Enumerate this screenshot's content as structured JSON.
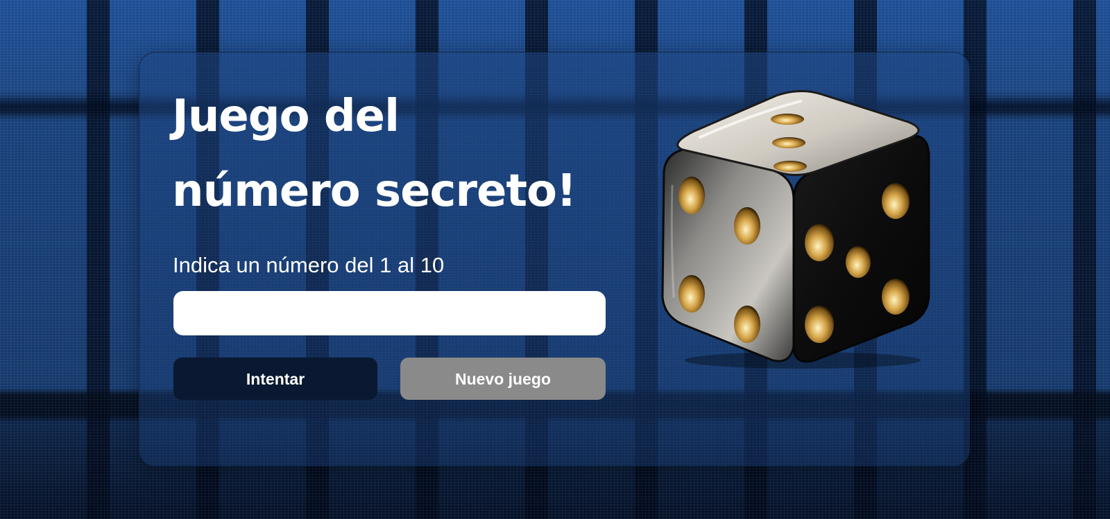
{
  "game": {
    "title_line1": "Juego del",
    "title_line2": "número secreto!",
    "prompt": "Indica un número del 1 al 10",
    "input_value": "",
    "try_button": "Intentar",
    "new_game_button": "Nuevo juego",
    "dice_image": "dice-icon"
  },
  "colors": {
    "background": "#1b4684",
    "try_button": "#0a1931",
    "new_game_button": "#8a8a8a",
    "input_background": "#ffffff",
    "text": "#ffffff"
  }
}
